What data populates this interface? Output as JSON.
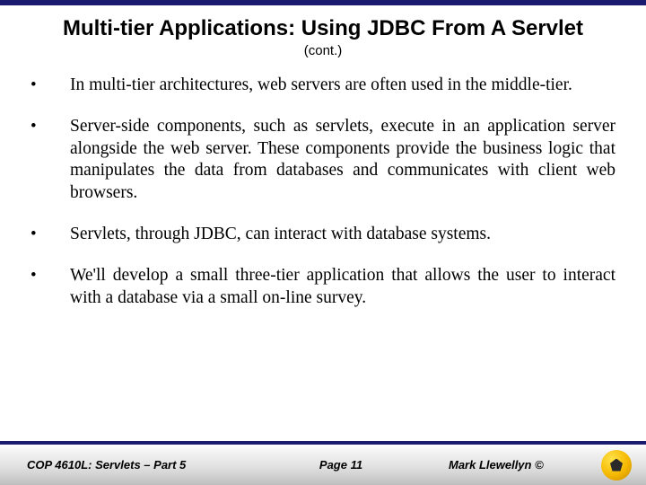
{
  "title": "Multi-tier Applications:  Using JDBC From A Servlet",
  "subtitle": "(cont.)",
  "bullets": [
    "In multi-tier architectures, web servers are often used in the middle-tier.",
    "Server-side components, such as servlets, execute in an application server alongside the web server.  These components provide the business logic that manipulates the data from databases and communicates with client web browsers.",
    "Servlets, through JDBC, can interact with database systems.",
    "We'll develop a small three-tier application that allows the user to interact with a database via a small on-line survey."
  ],
  "footer": {
    "left": "COP 4610L: Servlets – Part 5",
    "center": "Page 11",
    "right": "Mark Llewellyn ©"
  }
}
